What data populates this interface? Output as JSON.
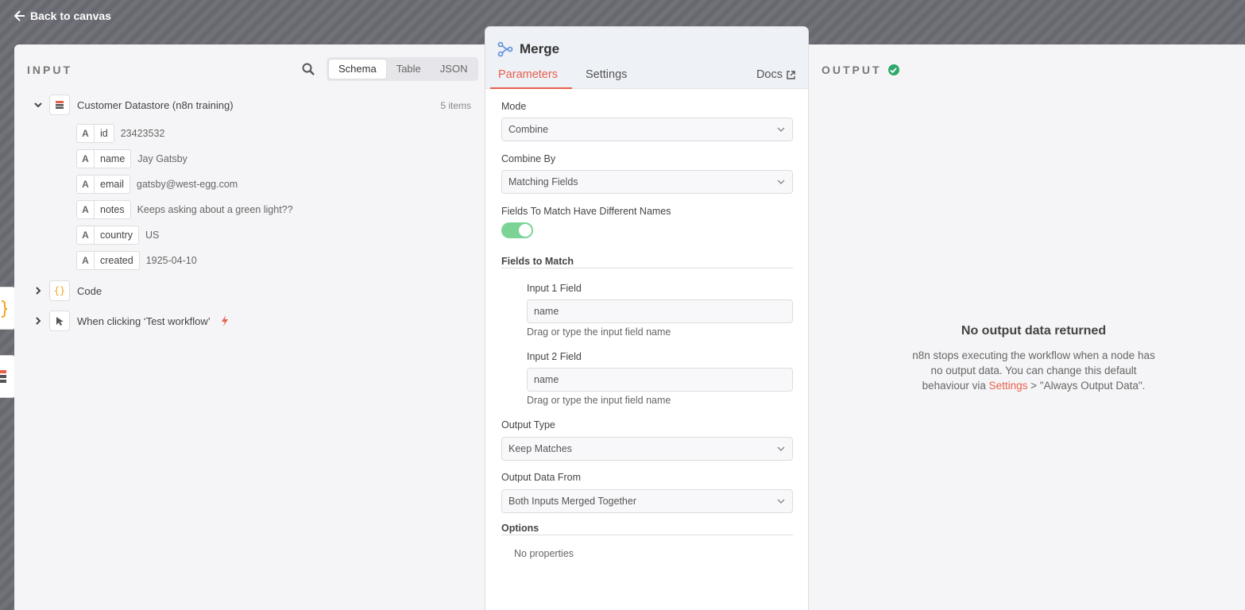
{
  "back_link": "Back to canvas",
  "input": {
    "title": "INPUT",
    "view_tabs": [
      "Schema",
      "Table",
      "JSON"
    ],
    "active_tab": "Schema",
    "node": {
      "name": "Customer Datastore (n8n training)",
      "count": "5 items",
      "fields": [
        {
          "type": "A",
          "key": "id",
          "value": "23423532"
        },
        {
          "type": "A",
          "key": "name",
          "value": "Jay Gatsby"
        },
        {
          "type": "A",
          "key": "email",
          "value": "gatsby@west-egg.com"
        },
        {
          "type": "A",
          "key": "notes",
          "value": "Keeps asking about a green light??"
        },
        {
          "type": "A",
          "key": "country",
          "value": "US"
        },
        {
          "type": "A",
          "key": "created",
          "value": "1925-04-10"
        }
      ]
    },
    "other_nodes": [
      {
        "name": "Code",
        "icon": "code-braces-icon"
      },
      {
        "name": "When clicking ‘Test workflow’",
        "icon": "cursor-icon"
      }
    ]
  },
  "merge": {
    "title": "Merge",
    "tabs": [
      "Parameters",
      "Settings"
    ],
    "docs": "Docs",
    "mode_label": "Mode",
    "mode_value": "Combine",
    "combine_by_label": "Combine By",
    "combine_by_value": "Matching Fields",
    "different_names_label": "Fields To Match Have Different Names",
    "different_names_on": true,
    "fields_to_match_title": "Fields to Match",
    "input1_label": "Input 1 Field",
    "input1_value": "name",
    "input1_hint": "Drag or type the input field name",
    "input2_label": "Input 2 Field",
    "input2_value": "name",
    "input2_hint": "Drag or type the input field name",
    "output_type_label": "Output Type",
    "output_type_value": "Keep Matches",
    "output_data_from_label": "Output Data From",
    "output_data_from_value": "Both Inputs Merged Together",
    "options_title": "Options",
    "no_properties": "No properties"
  },
  "output": {
    "title": "OUTPUT",
    "empty_title": "No output data returned",
    "empty_text_1": "n8n stops executing the workflow when a node has no output data. You can change this default behaviour via ",
    "empty_link": "Settings",
    "empty_text_2": " > \"Always Output Data\"."
  },
  "colors": {
    "accent": "#e8604c",
    "success": "#2fa86b",
    "toggle": "#7bd496"
  }
}
